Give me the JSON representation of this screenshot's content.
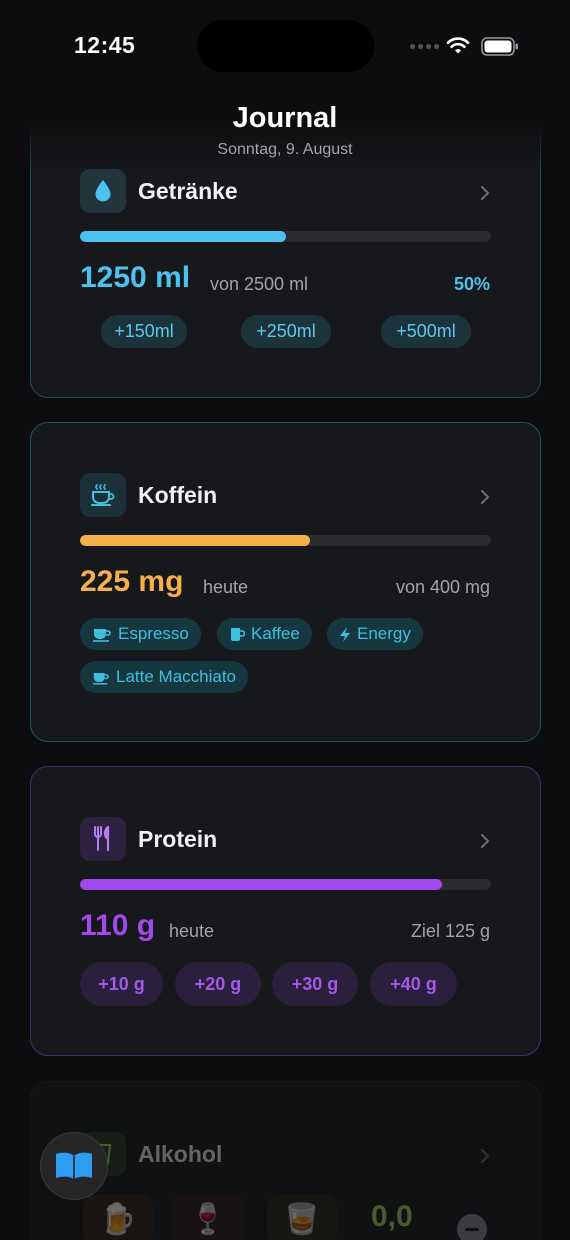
{
  "status": {
    "time": "12:45"
  },
  "header": {
    "title": "Journal",
    "subtitle": "Sonntag, 9. August"
  },
  "drinks": {
    "title": "Getränke",
    "amount": "1250 ml",
    "goal_text": "von 2500 ml",
    "percent_text": "50%",
    "progress": 0.5,
    "buttons": [
      "+150ml",
      "+250ml",
      "+500ml"
    ],
    "icon": "water-drop-icon",
    "accent": "#4cc3ef"
  },
  "caffeine": {
    "title": "Koffein",
    "amount": "225 mg",
    "today": "heute",
    "goal_text": "von 400 mg",
    "progress": 0.56,
    "chips": [
      {
        "label": "Espresso",
        "icon": "coffee-cup-icon"
      },
      {
        "label": "Kaffee",
        "icon": "mug-icon"
      },
      {
        "label": "Energy",
        "icon": "bolt-icon"
      },
      {
        "label": "Latte Macchiato",
        "icon": "coffee-cup-icon"
      }
    ],
    "icon": "hot-coffee-icon",
    "accent": "#f6b04a"
  },
  "protein": {
    "title": "Protein",
    "amount": "110 g",
    "today": "heute",
    "goal_text": "Ziel 125 g",
    "progress": 0.88,
    "buttons": [
      "+10 g",
      "+20 g",
      "+30 g",
      "+40 g"
    ],
    "icon": "fork-knife-icon",
    "accent": "#a149ee"
  },
  "alcohol": {
    "title": "Alkohol",
    "value": "0,0",
    "icons": [
      "beer-icon",
      "wine-glass-icon",
      "cocktail-icon"
    ]
  },
  "fab": {
    "icon": "book-icon"
  }
}
